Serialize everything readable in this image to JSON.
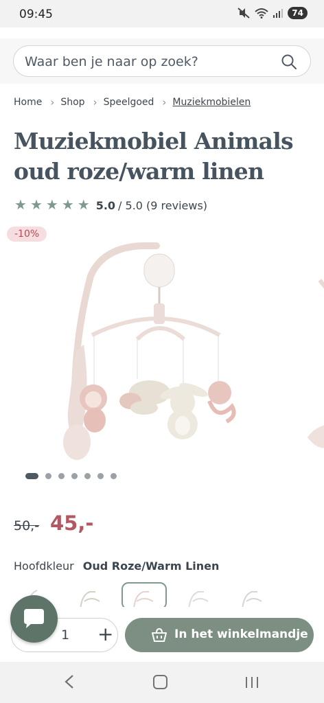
{
  "status_bar": {
    "time": "09:45",
    "battery": "74"
  },
  "search": {
    "placeholder": "Waar ben je naar op zoek?"
  },
  "breadcrumb": {
    "items": [
      "Home",
      "Shop",
      "Speelgoed"
    ],
    "current": "Muziekmobielen"
  },
  "product": {
    "title_line1": "Muziekmobiel Animals",
    "title_line2": "oud roze/warm linen",
    "rating_value": "5.0",
    "rating_rest": "/ 5.0 (9 reviews)",
    "stars": 5,
    "discount_badge": "-10%",
    "price_old": "50,-",
    "price_new": "45,-",
    "color_label": "Hoofdkleur",
    "color_value": "Oud Roze/Warm Linen"
  },
  "gallery": {
    "image_count": 7,
    "active_index": 0
  },
  "cart": {
    "quantity": "1",
    "button_label": "In het winkelmandje"
  },
  "colors": {
    "accent_green": "#7d8f82",
    "star": "#7f9a8c",
    "sale_price": "#b25862",
    "badge_bg": "#f6dde0",
    "chat_bg": "#5f7468"
  },
  "icons": [
    "search-icon",
    "chevron-right-icon",
    "star-icon",
    "basket-icon",
    "chat-icon",
    "plus-icon",
    "back-icon",
    "home-icon",
    "recents-icon"
  ]
}
